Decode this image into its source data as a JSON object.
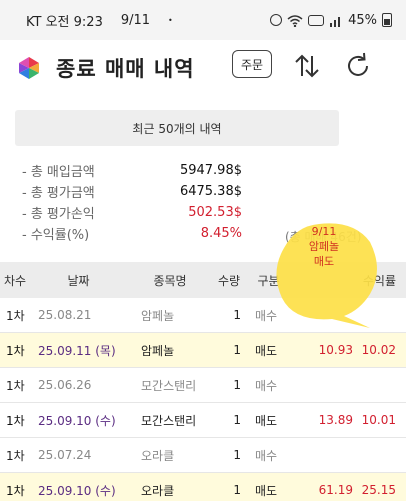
{
  "status_bar": {
    "carrier_time": "KT 오전 9:23",
    "date": "9/11",
    "dot": "•",
    "battery": "45%"
  },
  "header": {
    "title": "종료 매매 내역",
    "order_button": "주문",
    "icons": {
      "logo": "app-logo",
      "swap": "swap-vertical-icon",
      "refresh": "refresh-icon"
    }
  },
  "summary": {
    "banner": "최근 50개의 내역",
    "rows": [
      {
        "label": "- 총 매입금액",
        "value": "5947.98$"
      },
      {
        "label": "- 총 평가금액",
        "value": "6475.38$"
      },
      {
        "label": "- 총 평가손익",
        "value": "502.53$"
      },
      {
        "label": "- 수익률(%)",
        "value": "8.45%"
      }
    ],
    "count_note": "(총 매매 46건)",
    "accent_red": "#d21f2f"
  },
  "annotation": {
    "line1": "9/11",
    "line2": "암페놀",
    "line3": "매도",
    "bubble_color": "#fde047"
  },
  "table": {
    "headers": [
      "차수",
      "날짜",
      "종목명",
      "수량",
      "구분",
      "",
      "수익률"
    ],
    "rows": [
      {
        "round": "1차",
        "date": "25.08.21",
        "name": "암페놀",
        "qty": "1",
        "type": "매수",
        "price": "",
        "rate": ""
      },
      {
        "round": "1차",
        "date": "25.09.11 (목)",
        "name": "암페놀",
        "qty": "1",
        "type": "매도",
        "price": "10.93",
        "rate": "10.02"
      },
      {
        "round": "1차",
        "date": "25.06.26",
        "name": "모간스탠리",
        "qty": "1",
        "type": "매수",
        "price": "",
        "rate": ""
      },
      {
        "round": "1차",
        "date": "25.09.10 (수)",
        "name": "모간스탠리",
        "qty": "1",
        "type": "매도",
        "price": "13.89",
        "rate": "10.01"
      },
      {
        "round": "1차",
        "date": "25.07.24",
        "name": "오라클",
        "qty": "1",
        "type": "매수",
        "price": "",
        "rate": ""
      },
      {
        "round": "1차",
        "date": "25.09.10 (수)",
        "name": "오라클",
        "qty": "1",
        "type": "매도",
        "price": "61.19",
        "rate": "25.15"
      }
    ]
  }
}
